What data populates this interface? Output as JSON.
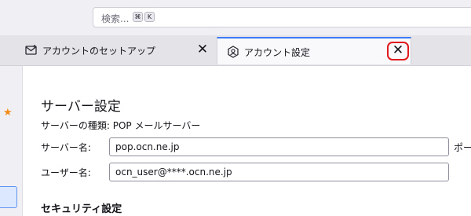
{
  "search": {
    "placeholder": "検索...",
    "shortcut_keys": [
      "⌘",
      "K"
    ]
  },
  "tabs": [
    {
      "label": "アカウントのセットアップ",
      "icon": "account-setup-icon",
      "close": "✕"
    },
    {
      "label": "アカウント設定",
      "icon": "account-settings-icon",
      "close": "✕",
      "active": true
    }
  ],
  "sidebar": {
    "star_icon": "star-icon"
  },
  "server_settings": {
    "title": "サーバー設定",
    "server_kind": "サーバーの種類: POP メールサーバー",
    "server_name_label": "サーバー名:",
    "server_name_value": "pop.ocn.ne.jp",
    "port_label": "ポー",
    "username_label": "ユーザー名:",
    "username_value": "ocn_user@****.ocn.ne.jp"
  },
  "security_settings": {
    "title": "セキュリティ設定"
  },
  "colors": {
    "active_tab_accent": "#3b7bf6",
    "highlight_red": "#e0191c",
    "star_orange": "#f38b17"
  }
}
